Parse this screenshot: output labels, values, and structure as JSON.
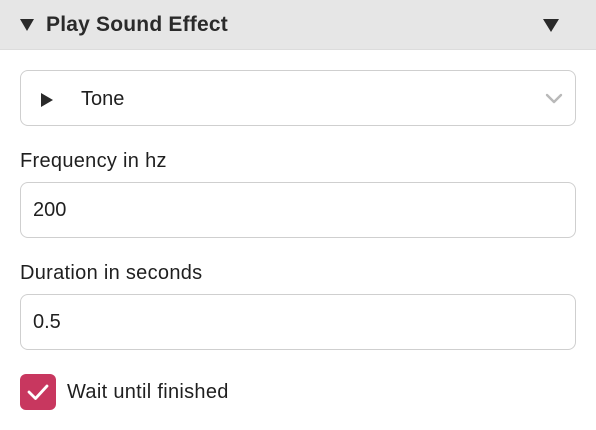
{
  "header": {
    "title": "Play Sound Effect",
    "collapse_icon": "triangle-down-icon",
    "menu_icon": "triangle-down-icon"
  },
  "sound_select": {
    "selected": "Tone",
    "leading_icon": "play-icon",
    "trailing_icon": "chevron-down-icon"
  },
  "frequency": {
    "label": "Frequency in hz",
    "value": "200"
  },
  "duration": {
    "label": "Duration in seconds",
    "value": "0.5"
  },
  "wait": {
    "label": "Wait until finished",
    "checked": true,
    "accent_color": "#c8375f"
  }
}
